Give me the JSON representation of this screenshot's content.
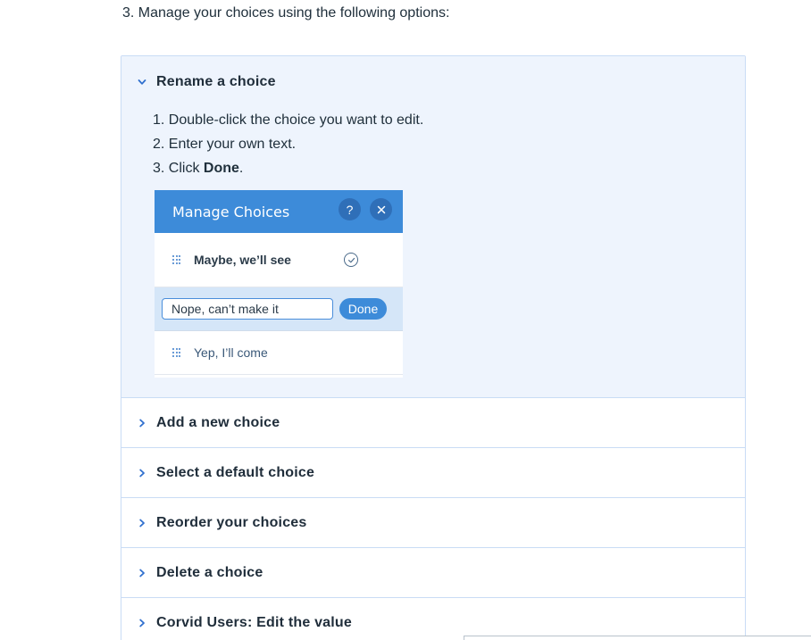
{
  "intro": {
    "text": "3.  Manage your choices using the following options:"
  },
  "accordion": {
    "open_item": {
      "title": "Rename a choice",
      "steps": [
        {
          "prefix": "1.  Double-click the choice you want to edit.",
          "bold": "",
          "suffix": ""
        },
        {
          "prefix": "2.  Enter your own text.",
          "bold": "",
          "suffix": ""
        },
        {
          "prefix": "3.  Click ",
          "bold": "Done",
          "suffix": "."
        }
      ],
      "screenshot": {
        "title": "Manage Choices",
        "help_label": "?",
        "close_label": "✕",
        "row1_label": "Maybe, we’ll see",
        "edit_value": "Nope, can’t make it",
        "done_label": "Done",
        "row3_label": "Yep, I’ll come"
      }
    },
    "items": [
      {
        "title": "Add a new choice"
      },
      {
        "title": "Select a default choice"
      },
      {
        "title": "Reorder your choices"
      },
      {
        "title": "Delete a choice"
      },
      {
        "title": "Corvid Users: Edit the value"
      }
    ]
  },
  "colors": {
    "accent": "#3d8bd9",
    "panel_bg": "#eef4fd",
    "border": "#c9dcf5",
    "chevron": "#2f6fce"
  },
  "icons": {
    "expanded": "chevron-down-icon",
    "collapsed": "chevron-right-icon",
    "drag": "drag-handle-icon",
    "check": "check-circle-icon"
  }
}
